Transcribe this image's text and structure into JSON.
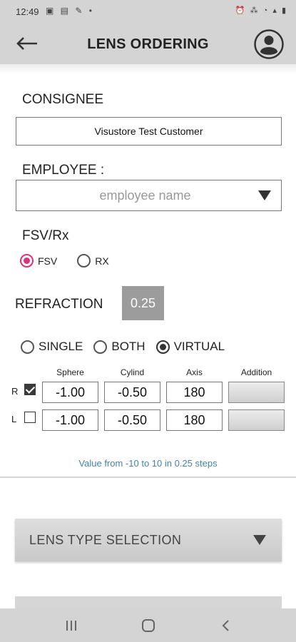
{
  "status_bar": {
    "time": "12:49",
    "left_icons": "▣ ▤ ✎ •",
    "right_icons": "⏰ ⁂ ◔ ▴ ▮"
  },
  "header": {
    "title": "LENS ORDERING"
  },
  "consignee": {
    "label": "CONSIGNEE",
    "value": "Visustore Test Customer"
  },
  "employee": {
    "label": "EMPLOYEE :",
    "placeholder": "employee name"
  },
  "fsv_rx": {
    "label": "FSV/Rx",
    "options": [
      "FSV",
      "RX"
    ],
    "selected": "FSV"
  },
  "refraction": {
    "label": "REFRACTION",
    "step_value": "0.25"
  },
  "mode": {
    "options": [
      "SINGLE",
      "BOTH",
      "VIRTUAL"
    ],
    "selected": "VIRTUAL"
  },
  "table": {
    "headers": [
      "Sphere",
      "Cylind",
      "Axis",
      "Addition"
    ],
    "rows": [
      {
        "eye": "R",
        "checked": true,
        "sphere": "-1.00",
        "cylinder": "-0.50",
        "axis": "180",
        "addition": ""
      },
      {
        "eye": "L",
        "checked": false,
        "sphere": "-1.00",
        "cylinder": "-0.50",
        "axis": "180",
        "addition": ""
      }
    ]
  },
  "hint": "Value from -10 to 10 in 0.25 steps",
  "lens_type": {
    "label": "LENS TYPE SELECTION"
  },
  "colors": {
    "accent_pink": "#e0307a",
    "hint_blue": "#3f86a6",
    "header_gray": "#d4d4d4"
  }
}
